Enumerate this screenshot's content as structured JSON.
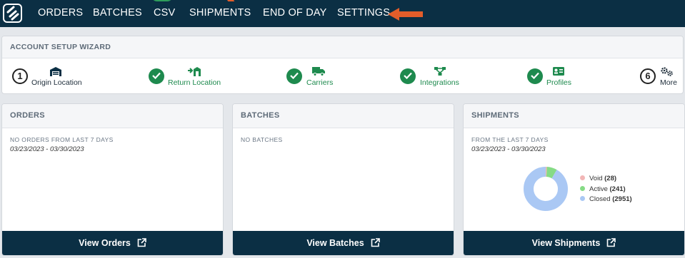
{
  "nav": {
    "items": [
      "ORDERS",
      "BATCHES",
      "CSV",
      "SHIPMENTS",
      "END OF DAY",
      "SETTINGS"
    ],
    "logo_icon": "shipping-logo",
    "arrow_color": "#e35d2a"
  },
  "wizard": {
    "title": "ACCOUNT SETUP WIZARD",
    "steps": [
      {
        "label": "Origin Location",
        "state": "current",
        "number": "1",
        "icon": "warehouse-icon"
      },
      {
        "label": "Return Location",
        "state": "done",
        "icon": "return-arrow-icon"
      },
      {
        "label": "Carriers",
        "state": "done",
        "icon": "truck-icon"
      },
      {
        "label": "Integrations",
        "state": "done",
        "icon": "network-icon"
      },
      {
        "label": "Profiles",
        "state": "done",
        "icon": "id-card-icon"
      },
      {
        "label": "More",
        "state": "pending",
        "number": "6",
        "icon": "gears-icon"
      }
    ]
  },
  "orders": {
    "title": "ORDERS",
    "subtitle": "NO ORDERS FROM LAST 7 DAYS",
    "date_range": "03/23/2023 - 03/30/2023",
    "button": "View Orders"
  },
  "batches": {
    "title": "BATCHES",
    "subtitle": "NO BATCHES",
    "button": "View Batches"
  },
  "shipments": {
    "title": "SHIPMENTS",
    "subtitle": "FROM THE LAST 7 DAYS",
    "date_range": "03/23/2023 - 03/30/2023",
    "button": "View Shipments",
    "legend": [
      {
        "label": "Void",
        "count": "(28)",
        "value": 28,
        "color": "#f2b6b6"
      },
      {
        "label": "Active",
        "count": "(241)",
        "value": 241,
        "color": "#86db86"
      },
      {
        "label": "Closed",
        "count": "(2951)",
        "value": 2951,
        "color": "#aac8f4"
      }
    ]
  },
  "colors": {
    "nav_bg": "#0b2f44",
    "accent_green": "#1e8a4e",
    "button_bg": "#0b2f44"
  }
}
